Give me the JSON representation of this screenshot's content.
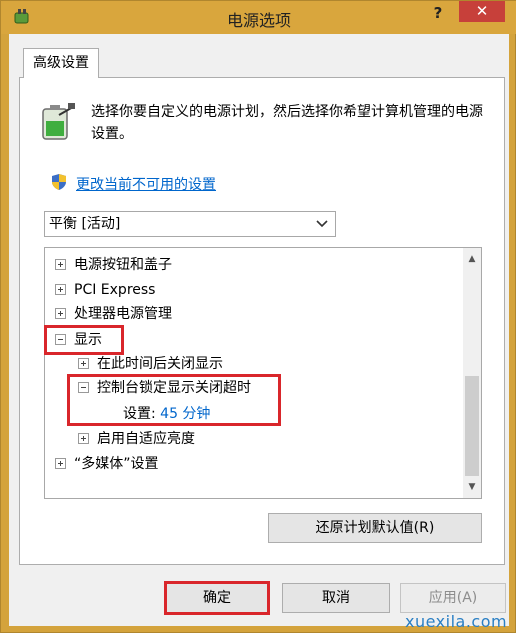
{
  "window": {
    "title": "电源选项",
    "help": "?",
    "close": "✕"
  },
  "tab": {
    "label": "高级设置"
  },
  "description": "选择你要自定义的电源计划，然后选择你希望计算机管理的电源设置。",
  "change_link": "更改当前不可用的设置",
  "plan_select": {
    "value": "平衡 [活动]"
  },
  "tree": {
    "items": [
      {
        "label": "电源按钮和盖子",
        "expander": "+"
      },
      {
        "label": "PCI Express",
        "expander": "+"
      },
      {
        "label": "处理器电源管理",
        "expander": "+"
      },
      {
        "label": "显示",
        "expander": "-"
      },
      {
        "label": "在此时间后关闭显示",
        "expander": "+"
      },
      {
        "label": "控制台锁定显示关闭超时",
        "expander": "-"
      },
      {
        "label": "设置:",
        "value": "45 分钟"
      },
      {
        "label": "启用自适应亮度",
        "expander": "+"
      },
      {
        "label": "“多媒体”设置",
        "expander": "+"
      }
    ]
  },
  "buttons": {
    "restore": "还原计划默认值(R)",
    "ok": "确定",
    "cancel": "取消",
    "apply": "应用(A)"
  },
  "watermark": "xuexila.com",
  "colors": {
    "titlebar": "#d9a63d",
    "link": "#0066cc",
    "highlight_box": "#d9262b",
    "close": "#c7403a"
  }
}
